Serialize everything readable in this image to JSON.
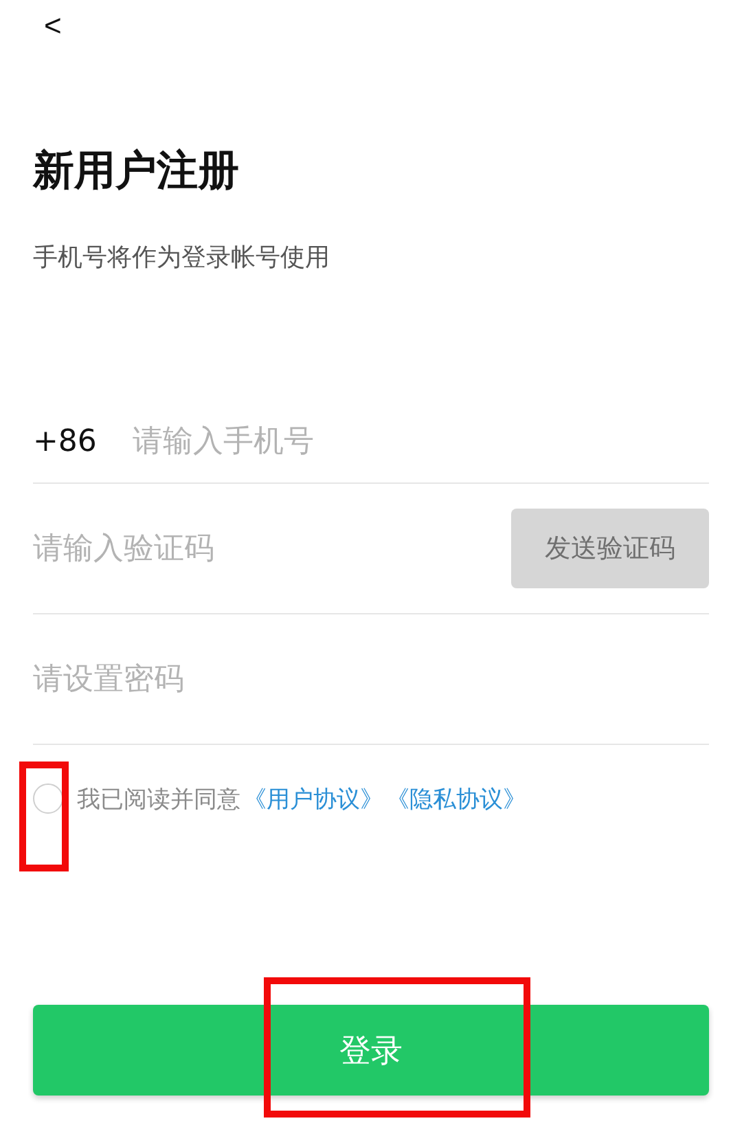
{
  "back": {
    "label": "<"
  },
  "title": "新用户注册",
  "subtitle": "手机号将作为登录帐号使用",
  "phone": {
    "prefix": "+86",
    "placeholder": "请输入手机号"
  },
  "code": {
    "placeholder": "请输入验证码",
    "button": {
      "label": "发送验证码",
      "disabled": true
    }
  },
  "password": {
    "placeholder": "请设置密码"
  },
  "agreement": {
    "checked": false,
    "highlighted": true,
    "text": "我已阅读并同意",
    "links": [
      "《用户协议》",
      "《隐私协议》"
    ]
  },
  "submit": {
    "label": "登录",
    "highlighted": true
  }
}
